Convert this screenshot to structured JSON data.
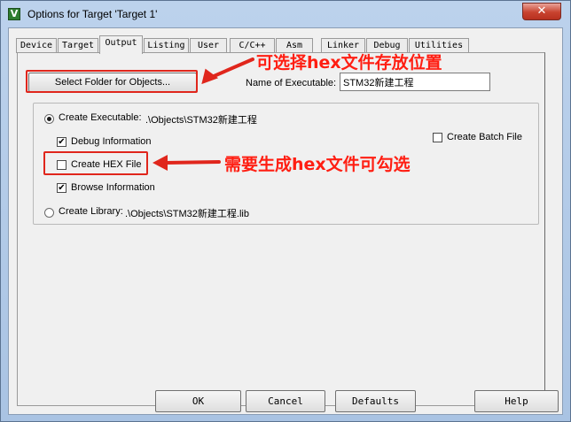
{
  "window": {
    "title": "Options for Target 'Target 1'",
    "app_icon_glyph": "V",
    "close_glyph": "✕"
  },
  "tabs": [
    {
      "label": "Device",
      "active": false
    },
    {
      "label": "Target",
      "active": false
    },
    {
      "label": "Output",
      "active": true
    },
    {
      "label": "Listing",
      "active": false
    },
    {
      "label": "User",
      "active": false
    },
    {
      "label": "C/C++",
      "active": false
    },
    {
      "label": "Asm",
      "active": false
    },
    {
      "label": "Linker",
      "active": false
    },
    {
      "label": "Debug",
      "active": false
    },
    {
      "label": "Utilities",
      "active": false
    }
  ],
  "output": {
    "select_folder_label": "Select Folder for Objects...",
    "name_of_executable_label": "Name of Executable:",
    "name_of_executable_value": "STM32新建工程",
    "create_executable_label": "Create Executable:",
    "create_executable_path": ".\\Objects\\STM32新建工程",
    "create_executable_selected": true,
    "debug_information_label": "Debug Information",
    "debug_information_checked": true,
    "create_hex_label": "Create HEX File",
    "create_hex_checked": false,
    "browse_information_label": "Browse Information",
    "browse_information_checked": true,
    "create_batch_label": "Create Batch File",
    "create_batch_checked": false,
    "create_library_label": "Create Library:",
    "create_library_path": ".\\Objects\\STM32新建工程.lib",
    "create_library_selected": false
  },
  "annotations": {
    "folder_note": "可选择hex文件存放位置",
    "hex_note": "需要生成hex文件可勾选",
    "color": "#ff1e12"
  },
  "footer": {
    "ok_label": "OK",
    "cancel_label": "Cancel",
    "defaults_label": "Defaults",
    "help_label": "Help"
  },
  "check_glyph": "✔"
}
